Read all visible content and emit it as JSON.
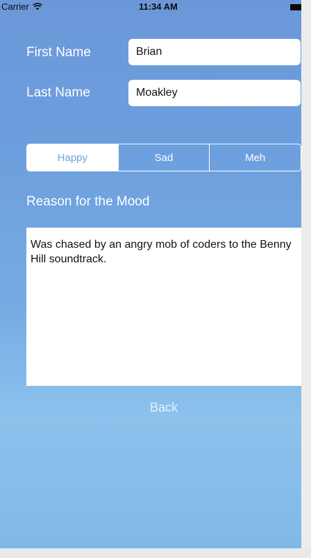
{
  "status_bar": {
    "carrier": "Carrier",
    "wifi_icon": "wifi-icon",
    "time": "11:34 AM",
    "battery_icon": "battery-icon"
  },
  "form": {
    "first_name": {
      "label": "First Name",
      "value": "Brian"
    },
    "last_name": {
      "label": "Last Name",
      "value": "Moakley"
    }
  },
  "mood_selector": {
    "options": [
      "Happy",
      "Sad",
      "Meh"
    ],
    "selected": "Happy"
  },
  "reason": {
    "title": "Reason for the Mood",
    "text": "Was chased by an angry mob of coders to the Benny Hill soundtrack."
  },
  "navigation": {
    "back_label": "Back"
  },
  "colors": {
    "background_top": "#6b98d8",
    "background_bottom": "#8cc2ec",
    "selected_segment_text": "#6fa0dc",
    "foreground": "#ffffff"
  }
}
